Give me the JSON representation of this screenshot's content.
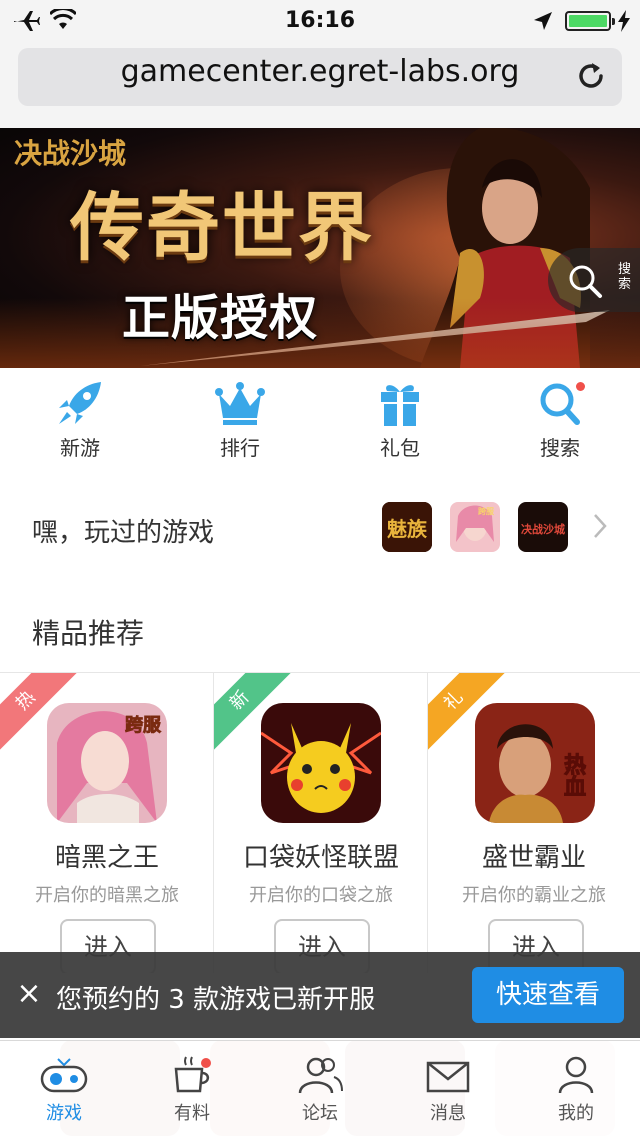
{
  "status_bar": {
    "time": "16:16"
  },
  "browser": {
    "url": "gamecenter.egret-labs.org"
  },
  "banner": {
    "logo_text": "决战沙城",
    "title": "传奇世界",
    "subtitle": "正版授权",
    "search_label": "搜索"
  },
  "quick_nav": [
    {
      "label": "新游",
      "icon": "rocket-icon"
    },
    {
      "label": "排行",
      "icon": "crown-icon"
    },
    {
      "label": "礼包",
      "icon": "gift-icon"
    },
    {
      "label": "搜索",
      "icon": "search-icon"
    }
  ],
  "recent": {
    "label": "嘿，玩过的游戏",
    "games": [
      "魅族",
      "跨服",
      "决战沙城"
    ]
  },
  "picks": {
    "title": "精品推荐",
    "games": [
      {
        "tag": "热",
        "tag_color": "#f2777a",
        "name": "暗黑之王",
        "desc": "开启你的暗黑之旅",
        "button": "进入",
        "badge": "跨服"
      },
      {
        "tag": "新",
        "tag_color": "#52c489",
        "name": "口袋妖怪联盟",
        "desc": "开启你的口袋之旅",
        "button": "进入"
      },
      {
        "tag": "礼",
        "tag_color": "#f5a623",
        "name": "盛世霸业",
        "desc": "开启你的霸业之旅",
        "button": "进入",
        "badge": "热血"
      }
    ]
  },
  "toast": {
    "close": "×",
    "message": "您预约的 3 款游戏已新开服",
    "action": "快速查看"
  },
  "tab_bar": {
    "tabs": [
      {
        "label": "游戏",
        "icon": "gamepad-icon",
        "active": true
      },
      {
        "label": "有料",
        "icon": "coffee-cup-icon"
      },
      {
        "label": "论坛",
        "icon": "users-icon"
      },
      {
        "label": "消息",
        "icon": "mail-icon"
      },
      {
        "label": "我的",
        "icon": "profile-icon"
      }
    ]
  },
  "colors": {
    "accent": "#1f8de4",
    "nav_icon": "#3aa7e8",
    "notify_dot": "#f0504a"
  }
}
